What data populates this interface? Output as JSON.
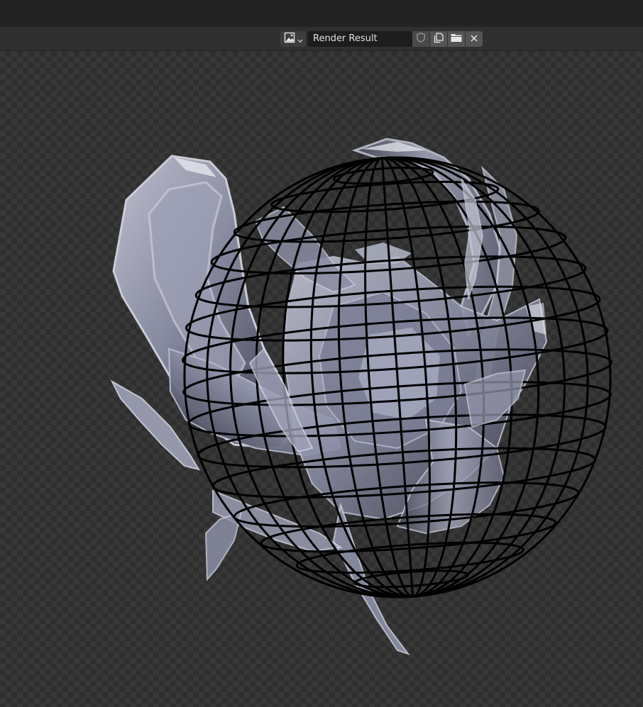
{
  "header": {
    "image_name": "Render Result",
    "image_type_icon": "image-icon",
    "dropdown_icon": "chevron-down-icon",
    "buttons": {
      "fake_user_icon": "shield-icon",
      "new_image_icon": "duplicate-icon",
      "open_image_icon": "folder-icon",
      "unlink_icon": "close-icon"
    }
  },
  "viewport": {
    "content": "render-result-image",
    "colors": {
      "checker_light": "#383838",
      "checker_dark": "#2f2f2f",
      "wireframe": "#000000",
      "glass": "#8f92a8"
    }
  }
}
